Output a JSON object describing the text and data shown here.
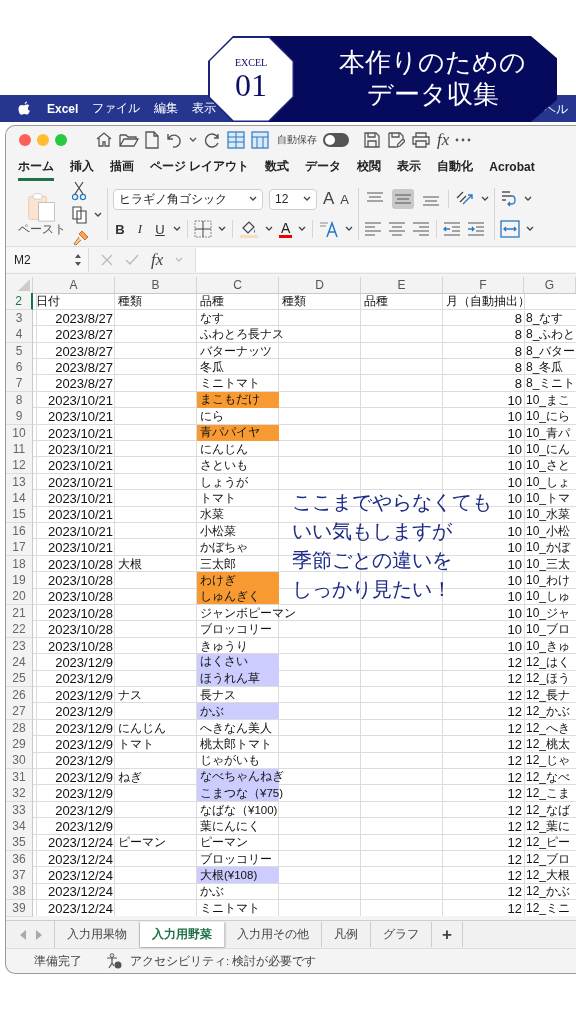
{
  "banner": {
    "label": "EXCEL",
    "number": "01",
    "title_lines": [
      "本作りのための",
      "データ収集"
    ]
  },
  "menu_bar": {
    "items": [
      "Excel",
      "ファイル",
      "編集",
      "表示"
    ],
    "trailing_item": "ヘル"
  },
  "quick_access": {
    "autosave_label": "自動保存",
    "autosave_on": false,
    "fx": "fx"
  },
  "tabs": [
    {
      "label": "ホーム",
      "selected": true
    },
    {
      "label": "挿入",
      "selected": false
    },
    {
      "label": "描画",
      "selected": false
    },
    {
      "label": "ページ レイアウト",
      "selected": false
    },
    {
      "label": "数式",
      "selected": false
    },
    {
      "label": "データ",
      "selected": false
    },
    {
      "label": "校閲",
      "selected": false
    },
    {
      "label": "表示",
      "selected": false
    },
    {
      "label": "自動化",
      "selected": false
    },
    {
      "label": "Acrobat",
      "selected": false
    }
  ],
  "ribbon": {
    "paste_label": "ペースト",
    "font_name": "ヒラギノ角ゴシック",
    "font_size": "12",
    "grow_font": "A",
    "shrink_font": "A",
    "format_buttons": [
      "B",
      "I",
      "U"
    ],
    "font_color_label": "A",
    "vertical_align": [
      {
        "selected": false
      },
      {
        "selected": true
      },
      {
        "selected": false
      }
    ]
  },
  "formula_bar": {
    "cell_ref": "M2",
    "fx": "fx"
  },
  "sheet": {
    "columns": [
      "A",
      "B",
      "C",
      "D",
      "E",
      "F",
      "G"
    ],
    "header_row": {
      "number": "2",
      "selected": true,
      "cells": [
        "日付",
        "種類",
        "品種",
        "種類",
        "品種",
        "月（自動抽出）"
      ]
    },
    "rows": [
      {
        "number": "3",
        "date": "2023/8/27",
        "variety": "なす",
        "month": "8",
        "key": "8_なす"
      },
      {
        "number": "4",
        "date": "2023/8/27",
        "variety": "ふわとろ長ナス",
        "month": "8",
        "key": "8_ふわと"
      },
      {
        "number": "5",
        "date": "2023/8/27",
        "variety": "バターナッツ",
        "month": "8",
        "key": "8_バター"
      },
      {
        "number": "6",
        "date": "2023/8/27",
        "variety": "冬瓜",
        "month": "8",
        "key": "8_冬瓜"
      },
      {
        "number": "7",
        "date": "2023/8/27",
        "variety": "ミニトマト",
        "month": "8",
        "key": "8_ミニト"
      },
      {
        "number": "8",
        "date": "2023/10/21",
        "variety": "まこもだけ",
        "color": "#f79a32",
        "month": "10",
        "key": "10_まこ"
      },
      {
        "number": "9",
        "date": "2023/10/21",
        "variety": "にら",
        "month": "10",
        "key": "10_にら"
      },
      {
        "number": "10",
        "date": "2023/10/21",
        "variety": "青パパイヤ",
        "color": "#f79a32",
        "month": "10",
        "key": "10_青パ"
      },
      {
        "number": "11",
        "date": "2023/10/21",
        "variety": "にんじん",
        "month": "10",
        "key": "10_にん"
      },
      {
        "number": "12",
        "date": "2023/10/21",
        "variety": "さといも",
        "month": "10",
        "key": "10_さと"
      },
      {
        "number": "13",
        "date": "2023/10/21",
        "variety": "しょうが",
        "month": "10",
        "key": "10_しょ"
      },
      {
        "number": "14",
        "date": "2023/10/21",
        "variety": "トマト",
        "month": "10",
        "key": "10_トマ"
      },
      {
        "number": "15",
        "date": "2023/10/21",
        "variety": "水菜",
        "month": "10",
        "key": "10_水菜"
      },
      {
        "number": "16",
        "date": "2023/10/21",
        "variety": "小松菜",
        "month": "10",
        "key": "10_小松"
      },
      {
        "number": "17",
        "date": "2023/10/21",
        "variety": "かぼちゃ",
        "month": "10",
        "key": "10_かぼ"
      },
      {
        "number": "18",
        "date": "2023/10/28",
        "category": "大根",
        "variety": "三太郎",
        "month": "10",
        "key": "10_三太"
      },
      {
        "number": "19",
        "date": "2023/10/28",
        "variety": "わけぎ",
        "color": "#f79a32",
        "month": "10",
        "key": "10_わけ"
      },
      {
        "number": "20",
        "date": "2023/10/28",
        "variety": "しゅんぎく",
        "color": "#f79a32",
        "month": "10",
        "key": "10_しゅ"
      },
      {
        "number": "21",
        "date": "2023/10/28",
        "variety": "ジャンボピーマン",
        "month": "10",
        "key": "10_ジャ"
      },
      {
        "number": "22",
        "date": "2023/10/28",
        "variety": "ブロッコリー",
        "month": "10",
        "key": "10_ブロ"
      },
      {
        "number": "23",
        "date": "2023/10/28",
        "variety": "きゅうり",
        "month": "10",
        "key": "10_きゅ"
      },
      {
        "number": "24",
        "date": "2023/12/9",
        "variety": "はくさい",
        "color": "#ccccff",
        "month": "12",
        "key": "12_はく"
      },
      {
        "number": "25",
        "date": "2023/12/9",
        "variety": "ほうれん草",
        "color": "#ccccff",
        "month": "12",
        "key": "12_ほう"
      },
      {
        "number": "26",
        "date": "2023/12/9",
        "category": "ナス",
        "variety": "長ナス",
        "month": "12",
        "key": "12_長ナ"
      },
      {
        "number": "27",
        "date": "2023/12/9",
        "variety": "かぶ",
        "color": "#ccccff",
        "month": "12",
        "key": "12_かぶ"
      },
      {
        "number": "28",
        "date": "2023/12/9",
        "category": "にんじん",
        "variety": "へきなん美人",
        "month": "12",
        "key": "12_へき"
      },
      {
        "number": "29",
        "date": "2023/12/9",
        "category": "トマト",
        "variety": "桃太郎トマト",
        "month": "12",
        "key": "12_桃太"
      },
      {
        "number": "30",
        "date": "2023/12/9",
        "variety": "じゃがいも",
        "month": "12",
        "key": "12_じゃ"
      },
      {
        "number": "31",
        "date": "2023/12/9",
        "category": "ねぎ",
        "variety": "なべちゃんねぎ",
        "color": "#ccccff",
        "month": "12",
        "key": "12_なべ"
      },
      {
        "number": "32",
        "date": "2023/12/9",
        "variety": "こまつな（¥75)",
        "color": "#ccccff",
        "month": "12",
        "key": "12_こま"
      },
      {
        "number": "33",
        "date": "2023/12/9",
        "variety": "なばな（¥100)",
        "month": "12",
        "key": "12_なば"
      },
      {
        "number": "34",
        "date": "2023/12/9",
        "variety": "葉にんにく",
        "month": "12",
        "key": "12_葉に"
      },
      {
        "number": "35",
        "date": "2023/12/24",
        "category": "ピーマン",
        "variety": "ピーマン",
        "month": "12",
        "key": "12_ピー"
      },
      {
        "number": "36",
        "date": "2023/12/24",
        "variety": "ブロッコリー",
        "month": "12",
        "key": "12_ブロ"
      },
      {
        "number": "37",
        "date": "2023/12/24",
        "variety": "大根(¥108)",
        "color": "#ccccff",
        "month": "12",
        "key": "12_大根"
      },
      {
        "number": "38",
        "date": "2023/12/24",
        "variety": "かぶ",
        "month": "12",
        "key": "12_かぶ"
      },
      {
        "number": "39",
        "date": "2023/12/24",
        "variety": "ミニトマト",
        "month": "12",
        "key": "12_ミニ"
      }
    ]
  },
  "annotation": {
    "lines": [
      "ここまでやらなくても",
      "いい気もしますが",
      "季節ごとの違いを",
      "しっかり見たい！"
    ]
  },
  "sheet_tabs": [
    {
      "label": "入力用果物",
      "selected": false
    },
    {
      "label": "入力用野菜",
      "selected": true
    },
    {
      "label": "入力用その他",
      "selected": false
    },
    {
      "label": "凡例",
      "selected": false
    },
    {
      "label": "グラフ",
      "selected": false
    }
  ],
  "add_sheet": "+",
  "status_bar": {
    "ready": "準備完了",
    "accessibility": "アクセシビリティ: 検討が必要です"
  }
}
